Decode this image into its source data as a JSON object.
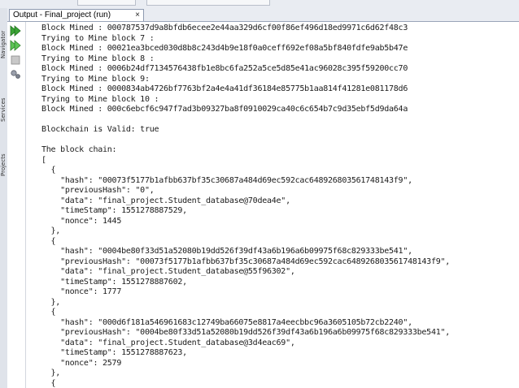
{
  "tab": {
    "title": "Output - Final_project (run)",
    "close": "×"
  },
  "side_tabs": [
    "Navigator",
    "Services",
    "Projects"
  ],
  "toolbar_icons": [
    "run-again-icon",
    "rerun-icon",
    "stop-icon",
    "settings-icon"
  ],
  "console_lines": [
    "Block Mined : 000787537d9a8bfdb6ecee2e44aa329d6cf00f86ef496d18ed9971c6d62f48c3",
    "Trying to Mine block 7 :",
    "Block Mined : 00021ea3bced030d8b8c243d4b9e18f0a0ceff692ef08a5bf840fdfe9ab5b47e",
    "Trying to Mine block 8 :",
    "Block Mined : 0006b24df7134576438fb1e8bc6fa252a5ce5d85e41ac96028c395f59200cc70",
    "Trying to Mine block 9:",
    "Block Mined : 0000834ab4726bf7763bf2a4e4a41df36184e85775b1aa814f41281e081178d6",
    "Trying to Mine block 10 :",
    "Block Mined : 000c6ebcf6c947f7ad3b09327ba8f0910029ca40c6c654b7c9d35ebf5d9da64a",
    "",
    "Blockchain is Valid: true",
    "",
    "The block chain:",
    "[",
    "  {",
    "    \"hash\": \"00073f5177b1afbb637bf35c30687a484d69ec592cac648926803561748143f9\",",
    "    \"previousHash\": \"0\",",
    "    \"data\": \"final_project.Student_database@70dea4e\",",
    "    \"timeStamp\": 1551278887529,",
    "    \"nonce\": 1445",
    "  },",
    "  {",
    "    \"hash\": \"0004be80f33d51a52080b19dd526f39df43a6b196a6b09975f68c829333be541\",",
    "    \"previousHash\": \"00073f5177b1afbb637bf35c30687a484d69ec592cac648926803561748143f9\",",
    "    \"data\": \"final_project.Student_database@55f96302\",",
    "    \"timeStamp\": 1551278887602,",
    "    \"nonce\": 1777",
    "  },",
    "  {",
    "    \"hash\": \"000d6f181a546961683c12749ba66075e8817a4eecbbc96a3605105b72cb2240\",",
    "    \"previousHash\": \"0004be80f33d51a52080b19dd526f39df43a6b196a6b09975f68c829333be541\",",
    "    \"data\": \"final_project.Student_database@3d4eac69\",",
    "    \"timeStamp\": 1551278887623,",
    "    \"nonce\": 2579",
    "  },",
    "  {"
  ],
  "colors": {
    "run_green": "#3aa335",
    "tab_border": "#8e9ab0"
  }
}
